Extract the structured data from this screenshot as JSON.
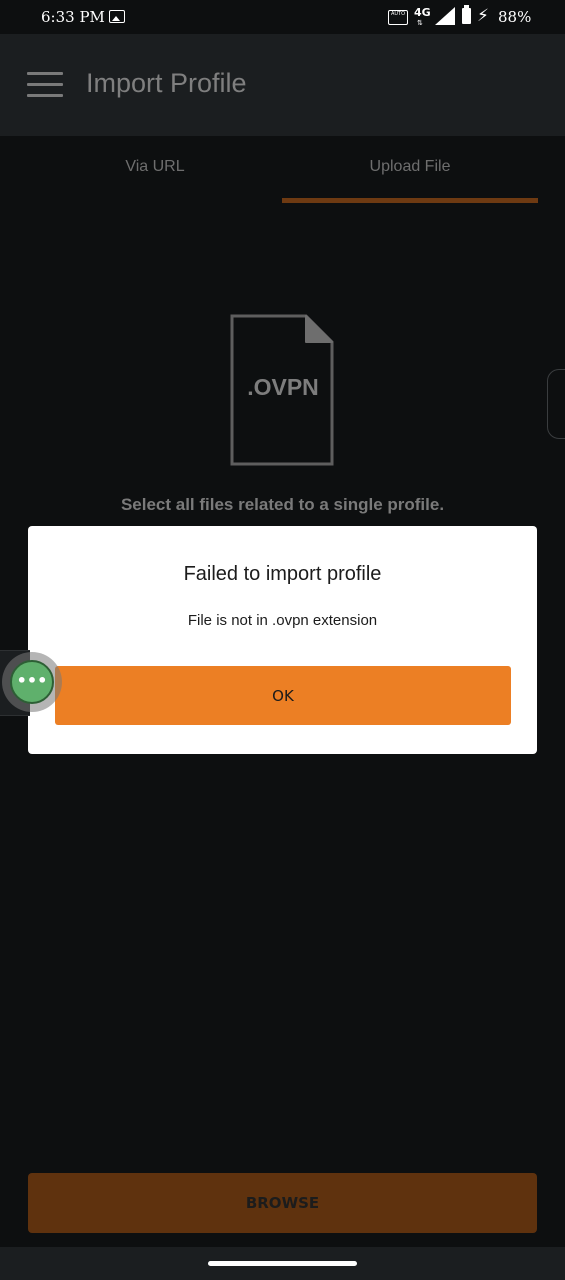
{
  "status_bar": {
    "time": "6:33 PM",
    "auto_label": "AUTO",
    "network": "4G",
    "network_arrows": "⇅",
    "battery_percent": "88%"
  },
  "app_bar": {
    "title": "Import Profile"
  },
  "tabs": {
    "items": [
      {
        "label": "Via URL",
        "selected": false
      },
      {
        "label": "Upload File",
        "selected": true
      }
    ]
  },
  "upload": {
    "file_type_label": ".OVPN",
    "instructions": "Select all files related to a single profile."
  },
  "dialog": {
    "title": "Failed to import profile",
    "message": "File is not in .ovpn extension",
    "ok_label": "OK"
  },
  "floating_bubble": {
    "glyph": "•••"
  },
  "browse_button": {
    "label": "BROWSE"
  },
  "colors": {
    "accent": "#ec7f24",
    "accent_dimmed": "#5f320e",
    "background": "#0d0f10",
    "app_bar": "#1b1e20",
    "dialog_background": "#ffffff"
  }
}
